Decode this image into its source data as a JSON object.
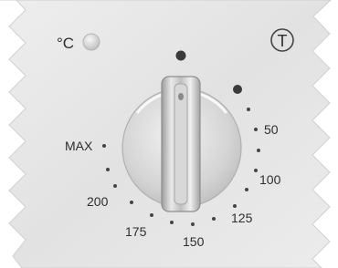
{
  "panel": {
    "unit_label": "°C",
    "thermostat_symbol": "T",
    "scale": {
      "max_label": "MAX",
      "marks": [
        "50",
        "100",
        "125",
        "150",
        "175",
        "200"
      ]
    },
    "colors": {
      "panel": "#e6e6e6",
      "dot": "#3a3a3a",
      "indicator_light": "#d9d9d9",
      "knob": "#d7d7d7"
    }
  }
}
